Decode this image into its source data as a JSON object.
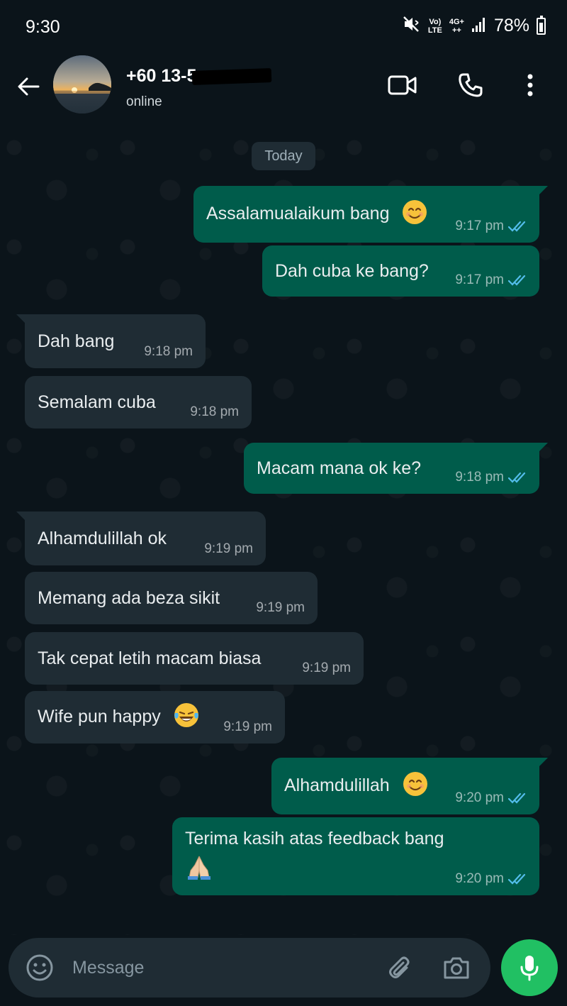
{
  "status_bar": {
    "time": "9:30",
    "net_top": "Vo)",
    "net_bottom": "LTE",
    "net4g_top": "4G+",
    "net4g_bottom": "++",
    "battery": "78%"
  },
  "header": {
    "contact_name": "+60 13-5",
    "contact_status": "online"
  },
  "chat": {
    "date_chip": "Today",
    "messages": [
      {
        "direction": "out",
        "text": "Assalamualaikum bang",
        "emoji": "smiling-face-icon",
        "time": "9:17 pm",
        "read": true
      },
      {
        "direction": "out",
        "text": "Dah cuba ke bang?",
        "time": "9:17 pm",
        "read": true
      },
      {
        "direction": "in",
        "text": "Dah bang",
        "time": "9:18 pm"
      },
      {
        "direction": "in",
        "text": "Semalam cuba",
        "time": "9:18 pm"
      },
      {
        "direction": "out",
        "text": "Macam mana ok ke?",
        "time": "9:18 pm",
        "read": true
      },
      {
        "direction": "in",
        "text": "Alhamdulillah ok",
        "time": "9:19 pm"
      },
      {
        "direction": "in",
        "text": "Memang ada beza sikit",
        "time": "9:19 pm"
      },
      {
        "direction": "in",
        "text": "Tak cepat letih macam biasa",
        "time": "9:19 pm"
      },
      {
        "direction": "in",
        "text": "Wife pun happy",
        "emoji": "tears-of-joy-icon",
        "time": "9:19 pm"
      },
      {
        "direction": "out",
        "text": "Alhamdulillah",
        "emoji": "smiling-face-icon",
        "time": "9:20 pm",
        "read": true
      },
      {
        "direction": "out",
        "text": "Terima kasih atas feedback bang",
        "emoji": "folded-hands-icon",
        "time": "9:20 pm",
        "read": true
      }
    ]
  },
  "input": {
    "placeholder": "Message",
    "value": ""
  },
  "colors": {
    "background": "#0b141a",
    "outgoing_bubble": "#005c4b",
    "incoming_bubble": "#1f2c34",
    "read_ticks": "#53bdeb",
    "mic_button": "#21c063"
  }
}
